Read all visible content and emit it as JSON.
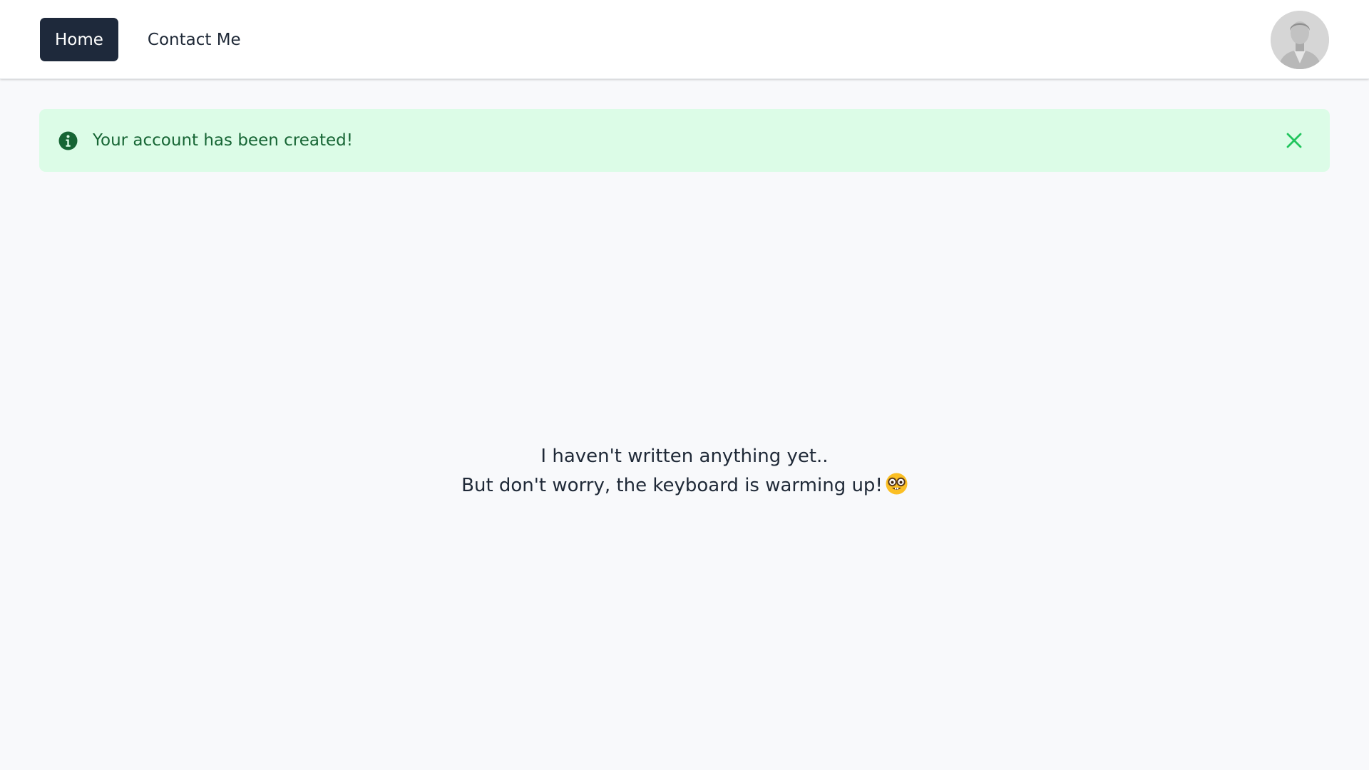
{
  "nav": {
    "home_label": "Home",
    "contact_label": "Contact Me",
    "avatar_icon": "user-avatar-icon"
  },
  "alert": {
    "message": "Your account has been created!",
    "icon": "info-icon",
    "close_icon": "close-icon",
    "colors": {
      "background": "#dcfce7",
      "text": "#166534",
      "close": "#22c55e"
    }
  },
  "empty_state": {
    "line1": "I haven't written anything yet..",
    "line2": "But don't worry, the keyboard is warming up!",
    "emoji_icon": "nerd-face-emoji-icon"
  },
  "colors": {
    "active_nav_bg": "#1e293b",
    "page_bg": "#f8f9fb"
  }
}
